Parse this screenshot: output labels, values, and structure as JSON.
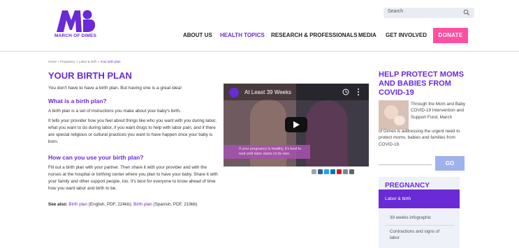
{
  "brand": {
    "name": "MARCH OF DIMES",
    "color": "#6a2ad6"
  },
  "search": {
    "placeholder": "Search"
  },
  "nav": {
    "items": [
      "ABOUT US",
      "HEALTH TOPICS",
      "RESEARCH & PROFESSIONALS",
      "MEDIA",
      "GET INVOLVED"
    ],
    "active": "HEALTH TOPICS",
    "donate": "DONATE",
    "donate_color": "#ff4fa3"
  },
  "breadcrumb": {
    "items": [
      "Home",
      "Pregnancy",
      "Labor & birth"
    ],
    "current": "Your birth plan",
    "separator": " > "
  },
  "article": {
    "title": "YOUR BIRTH PLAN",
    "intro": "You don't have to have a birth plan. But having one is a great idea!",
    "section1_heading": "What is a birth plan?",
    "section1_p1": "A birth plan is a set of instructions you make about your baby's birth.",
    "section1_p2": "It tells your provider how you feel about things like who you want with you during labor, what you want to do during labor, if you want drugs to help with labor pain, and if there are special religious or cultural practices you want to have happen once your baby is born.",
    "section2_heading": "How can you use your birth plan?",
    "section2_p1": "Fill out a birth plan with your partner. Then share it with your provider and with the nurses at the hospital or birthing center where you plan to have your baby. Share it with your family and other support people, too. It's best for everyone to know ahead of time how you want labor and birth to be.",
    "see_also_label": "See also:",
    "see_also_link1": "Birth plan",
    "see_also_link1_meta": "(English, PDF, 224kb),",
    "see_also_link2": "Birth plan",
    "see_also_link2_meta": "(Spanish, PDF, 219kb)"
  },
  "video": {
    "title": "At Least 39 Weeks",
    "caption": "If your pregnancy is healthy, it's best to wait until labor starts on its own."
  },
  "share": {
    "icons": [
      "email-icon",
      "facebook-icon",
      "twitter-icon",
      "linkedin-icon",
      "pinterest-icon",
      "sms-icon",
      "print-icon"
    ],
    "colors": [
      "#9aa4b1",
      "#3b5998",
      "#1da1f2",
      "#0077b5",
      "#cb2027",
      "#7a8796",
      "#5d6670"
    ]
  },
  "sidebar": {
    "title": "HELP PROTECT MOMS AND BABIES FROM COVID-19",
    "text_right": "Through the Mom and Baby COVID-19 Intervention and Support Fund, March",
    "text_full": "of Dimes is addressing the urgent need to protect moms, babies and families from COVID-19.",
    "go": "GO",
    "section_title": "PREGNANCY",
    "active_item": "Labor & birth",
    "items": [
      "39 weeks infographic",
      "Contractions and signs of labor"
    ]
  }
}
